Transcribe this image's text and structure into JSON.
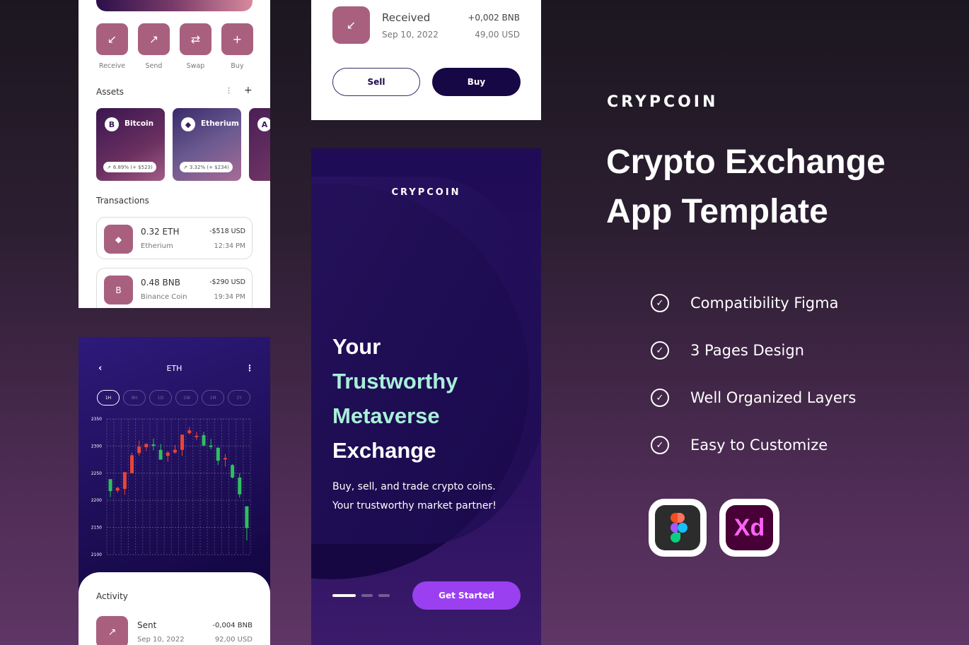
{
  "wallet": {
    "actions": [
      {
        "label": "Receive",
        "icon": "trend-down-icon"
      },
      {
        "label": "Send",
        "icon": "trend-up-icon"
      },
      {
        "label": "Swap",
        "icon": "swap-icon"
      },
      {
        "label": "Buy",
        "icon": "plus-icon"
      }
    ],
    "assets_title": "Assets",
    "assets": [
      {
        "name": "Bitcoin",
        "symbol": "B",
        "change": "6.89% (+ $523)"
      },
      {
        "name": "Etherium",
        "symbol": "◆",
        "change": "3.32% (+ $234)"
      },
      {
        "name": "",
        "symbol": "A",
        "change": ""
      }
    ],
    "transactions_title": "Transactions",
    "transactions": [
      {
        "amount": "0.32 ETH",
        "coin": "Etherium",
        "usd": "-$518 USD",
        "time": "12:34 PM",
        "icon": "◆"
      },
      {
        "amount": "0.48 BNB",
        "coin": "Binance Coin",
        "usd": "-$290 USD",
        "time": "19:34 PM",
        "icon": "B"
      }
    ]
  },
  "detail": {
    "received": {
      "title": "Received",
      "date": "Sep 10, 2022",
      "amount": "+0,002 BNB",
      "usd": "49,00 USD"
    },
    "sell_label": "Sell",
    "buy_label": "Buy"
  },
  "chart_screen": {
    "title": "ETH",
    "tabs": [
      "1H",
      "8H",
      "1D",
      "1W",
      "1M",
      "1Y"
    ],
    "active_tab": "1H",
    "activity_title": "Activity",
    "activity": {
      "title": "Sent",
      "date": "Sep 10, 2022",
      "amount": "-0,004 BNB",
      "usd": "92,00 USD"
    }
  },
  "chart_data": {
    "type": "candlestick",
    "ylim": [
      2100,
      2350
    ],
    "yticks": [
      "2350",
      "2300",
      "2250",
      "2200",
      "2150",
      "2100"
    ],
    "grid": true,
    "colors": {
      "up": "#2fbf5f",
      "down": "#e8453a"
    },
    "candles": [
      {
        "o": 2217,
        "c": 2239,
        "h": 2239,
        "l": 2206,
        "color": "up"
      },
      {
        "o": 2223,
        "c": 2218,
        "h": 2225,
        "l": 2214,
        "color": "down"
      },
      {
        "o": 2252,
        "c": 2221,
        "h": 2252,
        "l": 2210,
        "color": "down"
      },
      {
        "o": 2283,
        "c": 2250,
        "h": 2288,
        "l": 2250,
        "color": "down"
      },
      {
        "o": 2299,
        "c": 2287,
        "h": 2310,
        "l": 2282,
        "color": "down"
      },
      {
        "o": 2304,
        "c": 2298,
        "h": 2305,
        "l": 2291,
        "color": "down"
      },
      {
        "o": 2303,
        "c": 2302,
        "h": 2314,
        "l": 2292,
        "color": "up"
      },
      {
        "o": 2275,
        "c": 2293,
        "h": 2304,
        "l": 2275,
        "color": "up"
      },
      {
        "o": 2288,
        "c": 2282,
        "h": 2291,
        "l": 2271,
        "color": "down"
      },
      {
        "o": 2293,
        "c": 2288,
        "h": 2302,
        "l": 2286,
        "color": "down"
      },
      {
        "o": 2321,
        "c": 2293,
        "h": 2321,
        "l": 2282,
        "color": "down"
      },
      {
        "o": 2329,
        "c": 2324,
        "h": 2335,
        "l": 2321,
        "color": "down"
      },
      {
        "o": 2319,
        "c": 2317,
        "h": 2326,
        "l": 2311,
        "color": "down"
      },
      {
        "o": 2301,
        "c": 2320,
        "h": 2326,
        "l": 2299,
        "color": "up"
      },
      {
        "o": 2301,
        "c": 2300,
        "h": 2313,
        "l": 2294,
        "color": "up"
      },
      {
        "o": 2273,
        "c": 2297,
        "h": 2297,
        "l": 2265,
        "color": "up"
      },
      {
        "o": 2278,
        "c": 2276,
        "h": 2285,
        "l": 2262,
        "color": "down"
      },
      {
        "o": 2242,
        "c": 2265,
        "h": 2267,
        "l": 2240,
        "color": "up"
      },
      {
        "o": 2211,
        "c": 2242,
        "h": 2250,
        "l": 2205,
        "color": "up"
      },
      {
        "o": 2149,
        "c": 2189,
        "h": 2189,
        "l": 2126,
        "color": "up"
      }
    ]
  },
  "onboarding": {
    "brand": "CRYPCOIN",
    "headline": [
      "Your",
      "Trustworthy",
      "Metaverse",
      "Exchange"
    ],
    "subtitle": [
      "Buy, sell, and trade crypto coins.",
      "Your trustworthy market partner!"
    ],
    "cta": "Get Started",
    "page_indicator": {
      "pages": 3,
      "current": 1
    }
  },
  "promo": {
    "brand": "CRYPCOIN",
    "title": [
      "Crypto Exchange",
      "App Template"
    ],
    "features": [
      "Compatibility Figma",
      "3 Pages Design",
      "Well Organized Layers",
      "Easy to Customize"
    ],
    "tools": [
      {
        "name": "Figma",
        "icon": "figma-icon"
      },
      {
        "name": "Xd",
        "icon": "adobe-xd-icon"
      }
    ],
    "accent_colors": {
      "mint": "#a8f0d8",
      "cta": "#9a40f0",
      "tile": "#a9607f"
    }
  }
}
